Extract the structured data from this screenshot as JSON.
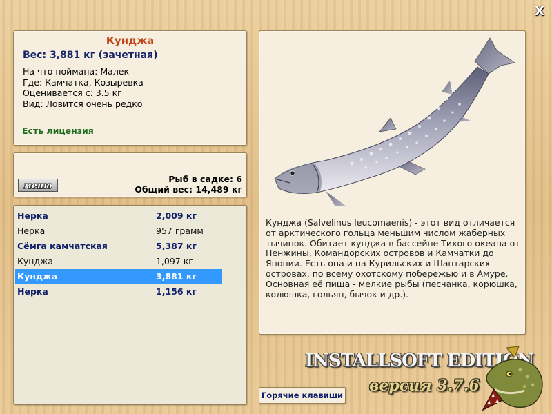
{
  "close_label": "X",
  "info": {
    "title": "Кунджа",
    "weight": "Вес: 3,881 кг (зачетная)",
    "caught_on": "На что поймана: Малек",
    "location": "Где: Камчатка, Козыревка",
    "valued_from": "Оценивается с: 3.5 кг",
    "kind": "Вид: Ловится очень редко",
    "license": "Есть лицензия"
  },
  "menu_panel": {
    "menu_label": "меню",
    "fish_in_net": "Рыб в садке: 6",
    "total_weight": "Общий вес: 14,489 кг"
  },
  "catch_list": [
    {
      "name": "Нерка",
      "weight": "2,009 кг",
      "style": "bold"
    },
    {
      "name": "Нерка",
      "weight": "957 грамм",
      "style": "plain"
    },
    {
      "name": "Сёмга камчатская",
      "weight": "5,387 кг",
      "style": "bold"
    },
    {
      "name": "Кунджа",
      "weight": "1,097 кг",
      "style": "plain"
    },
    {
      "name": "Кунджа",
      "weight": "3,881 кг",
      "style": "selected"
    },
    {
      "name": "Нерка",
      "weight": "1,156 кг",
      "style": "bold"
    }
  ],
  "fish_description": "Кунджа (Salvelinus leucomaenis) - этот вид отличается от арктического гольца меньшим числом жаберных тычинок. Обитает кунджа в бассейне Тихого океана от Пенжины, Командорских островов и Камчатки до Японии. Есть она и на Курильских и Шантарских островах, по всему охотскому побережью и в Амуре. Основная её пища - мелкие рыбы (песчанка, корюшка, колюшка, гольян, бычок и др.).",
  "hotkeys_label": "Горячие клавиши",
  "brand": {
    "edition": "INSTALLSOFT EDITION",
    "version": "версия 3.7.6"
  },
  "colors": {
    "title": "#c0461a",
    "weight": "#17236a",
    "license": "#1f6d1f",
    "selection": "#3399ff"
  }
}
